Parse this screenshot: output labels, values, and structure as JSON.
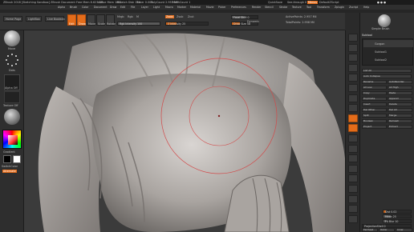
{
  "title_bar": {
    "app_title": "ZBrush 2018 [Sketching Sandbox]   ZBrush Document",
    "free_mem": "Free Mem 8.623 GB",
    "active_mem": "Active Mem 1862",
    "scratch_disk": "Scratch Disk 144",
    "timer": "Timer 0.001",
    "poly_count": "PolyCount 2.955 MP",
    "mesh_count": "MeshCount 1",
    "quicksave": "QuickSave",
    "see_through": "See-through 0",
    "menus_btn": "Menus",
    "default_script": "DefaultZScript"
  },
  "menubar": {
    "items": [
      "Alpha",
      "Brush",
      "Color",
      "Document",
      "Draw",
      "Edit",
      "File",
      "Layer",
      "Light",
      "Macro",
      "Marker",
      "Material",
      "Movie",
      "Picker",
      "Preferences",
      "Render",
      "Stencil",
      "Stroke",
      "Texture",
      "Tool",
      "Transform",
      "Zplugin",
      "Zscript",
      "Help"
    ]
  },
  "shelf": {
    "home_page": "Home Page",
    "lightbox": "LightBox",
    "live_boolean": "Live Boolean",
    "edit": "Edit",
    "draw": "Draw",
    "move": "Move",
    "scale": "Scale",
    "rotate": "Rotate",
    "mrgb": "Mrgb",
    "rgb": "Rgb",
    "m_btn": "M",
    "zadd": "Zadd",
    "zsub": "Zsub",
    "zcut": "Zcut",
    "rgb_intensity": "Rgb Intensity 100",
    "z_intensity": "Z Intensity 25",
    "focal_shift": "Focal Shift 0",
    "draw_size": "Draw Size 58",
    "dynamic": "Dynamic",
    "active_points": "ActivePoints: 2.957 Mil",
    "total_points": "TotalPoints: 2.958 Mil"
  },
  "left_shelf": {
    "brush_label": "Move",
    "stroke_label": "Dots",
    "alpha_label": "Alpha Off",
    "texture_label": "Texture Off",
    "material_label": "MatCap Gray",
    "gradient_label": "Gradient",
    "switch_color": "SwitchColor",
    "alternate": "Alternate"
  },
  "right_shelf": {
    "icons": [
      "bpr-icon",
      "spix-icon",
      "scroll-icon",
      "zoom-icon",
      "actual-icon",
      "aahalf-icon",
      "persp-icon",
      "floor-icon",
      "local-icon",
      "xyz-icon",
      "frame-icon",
      "move-icon",
      "scale-icon",
      "rotate-icon",
      "polyf-icon",
      "transp-icon",
      "ghost-icon",
      "solo-icon",
      "xpose-icon"
    ]
  },
  "tray": {
    "header": "Simple Brush",
    "subtool": "Subtool",
    "sub_items": [
      "Gorgon",
      "Subtool1",
      "Subtool2"
    ],
    "rows": [
      "List All",
      "Auto Collapse",
      "Rename",
      "AutoReorder",
      "All Low",
      "All High",
      "Copy",
      "Paste",
      "Duplicate",
      "Append",
      "Insert",
      "Delete",
      "Del Other",
      "Del All",
      "Split",
      "Merge",
      "Boolean",
      "Remesh",
      "Project",
      "Extract"
    ],
    "dist": "Dist 0.02",
    "mean": "Mean 25",
    "pa_blur": "PA Blur 10",
    "projection_shell": "ProjectionShell 0",
    "farthest": "Farthest",
    "outer": "Outer",
    "inner": "Inner"
  },
  "colors": {
    "accent": "#e46c1a",
    "brush_ring": "#d24a4a"
  }
}
